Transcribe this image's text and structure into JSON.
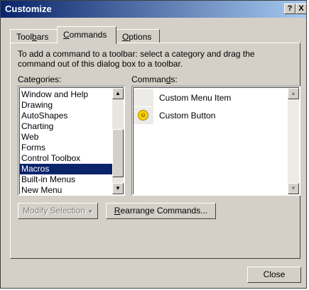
{
  "window": {
    "title": "Customize",
    "help_button": "?",
    "close_button": "X"
  },
  "tabs": [
    {
      "label": "Toolbars",
      "key": "b",
      "pre": "Tool",
      "post": "ars",
      "active": false
    },
    {
      "label": "Commands",
      "key": "C",
      "pre": "",
      "post": "ommands",
      "active": true
    },
    {
      "label": "Options",
      "key": "O",
      "pre": "",
      "post": "ptions",
      "active": false
    }
  ],
  "commands_tab": {
    "description": "To add a command to a toolbar: select a category and drag the command out of this dialog box to a toolbar.",
    "categories_label": {
      "pre": "Cate",
      "key": "g",
      "post": "ories:"
    },
    "commands_label": {
      "pre": "Comman",
      "key": "d",
      "post": "s:"
    },
    "categories": [
      "Window and Help",
      "Drawing",
      "AutoShapes",
      "Charting",
      "Web",
      "Forms",
      "Control Toolbox",
      "Macros",
      "Built-in Menus",
      "New Menu"
    ],
    "selected_category": "Macros",
    "commands": [
      {
        "label": "Custom Menu Item",
        "icon": "none"
      },
      {
        "label": "Custom Button",
        "icon": "smiley-icon"
      }
    ],
    "modify_selection_button": "Modify Selection",
    "rearrange_button": {
      "pre": "",
      "key": "R",
      "post": "earrange Commands..."
    }
  },
  "footer": {
    "close_button": "Close"
  }
}
